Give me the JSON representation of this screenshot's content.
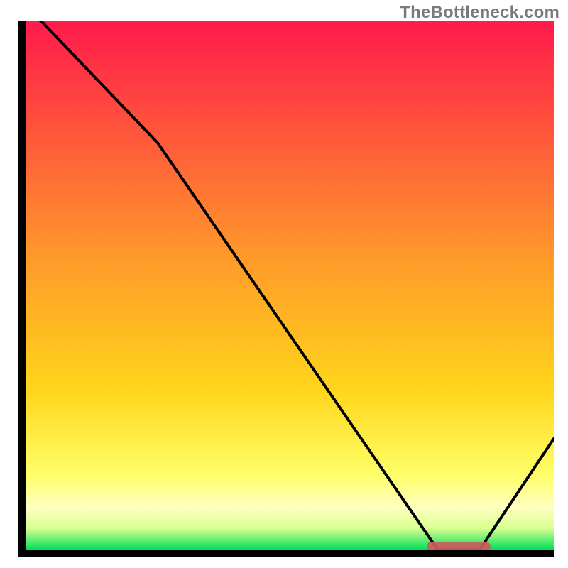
{
  "watermark": "TheBottleneck.com",
  "colors": {
    "top": "#ff1a4b",
    "mid1": "#ff7a33",
    "mid2": "#ffd61a",
    "band": "#ffff99",
    "green": "#00e05a",
    "axis": "#000000",
    "curve": "#000000",
    "marker": "#cd5c5c"
  },
  "chart_data": {
    "type": "line",
    "title": "",
    "xlabel": "",
    "ylabel": "",
    "xlim": [
      0,
      100
    ],
    "ylim": [
      0,
      100
    ],
    "x": [
      0,
      3,
      25,
      78,
      86,
      100
    ],
    "values": [
      102,
      100,
      77,
      0,
      0,
      21
    ],
    "marker": {
      "x_start": 76,
      "x_end": 88,
      "y": 0.6
    },
    "gradient_stops": [
      {
        "pct": 0,
        "color": "#ff1a4b"
      },
      {
        "pct": 45,
        "color": "#ff9a2a"
      },
      {
        "pct": 70,
        "color": "#ffd61a"
      },
      {
        "pct": 86,
        "color": "#ffff6a"
      },
      {
        "pct": 92,
        "color": "#ffffc0"
      },
      {
        "pct": 96,
        "color": "#d8ff90"
      },
      {
        "pct": 100,
        "color": "#00e05a"
      }
    ]
  }
}
